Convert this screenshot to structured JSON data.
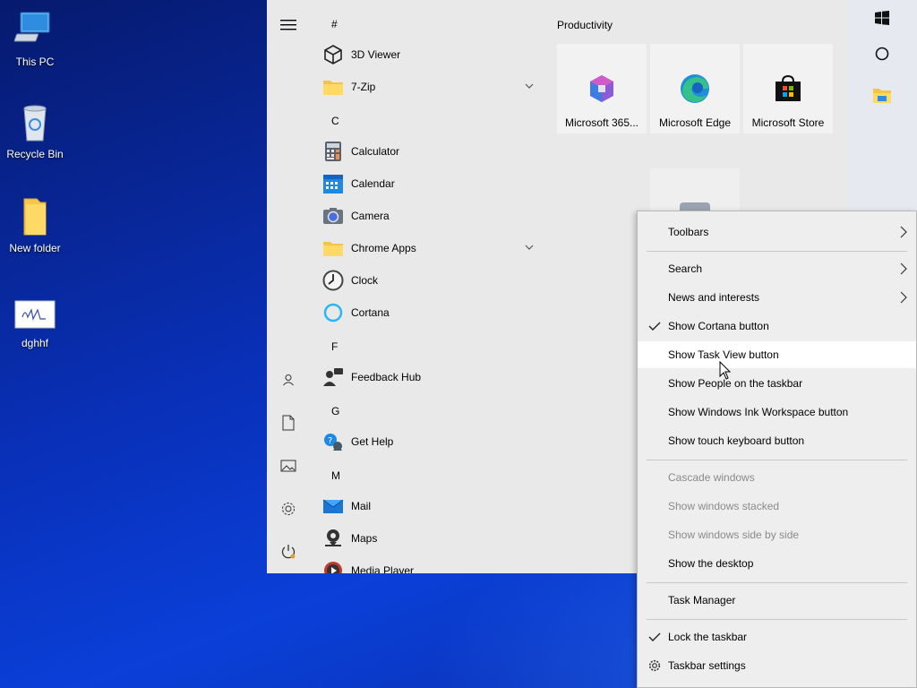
{
  "desktop": {
    "icons": [
      {
        "label": "This PC",
        "icon": "computer-icon"
      },
      {
        "label": "Recycle Bin",
        "icon": "recycle-bin-icon"
      },
      {
        "label": "New folder",
        "icon": "folder-icon"
      },
      {
        "label": "dghhf",
        "icon": "image-file-icon"
      }
    ]
  },
  "start_menu": {
    "rail": {
      "icons": [
        "hamburger-icon",
        "user-icon",
        "document-icon",
        "pictures-icon",
        "settings-icon",
        "power-icon"
      ]
    },
    "app_list": {
      "letters": [
        "#",
        "C",
        "F",
        "G",
        "M"
      ],
      "items": [
        {
          "label": "3D Viewer",
          "icon": "cube-icon"
        },
        {
          "label": "7-Zip",
          "icon": "folder-icon",
          "expandable": true
        },
        {
          "label": "Calculator",
          "icon": "calculator-icon"
        },
        {
          "label": "Calendar",
          "icon": "calendar-icon"
        },
        {
          "label": "Camera",
          "icon": "camera-icon"
        },
        {
          "label": "Chrome Apps",
          "icon": "folder-icon",
          "expandable": true
        },
        {
          "label": "Clock",
          "icon": "clock-icon"
        },
        {
          "label": "Cortana",
          "icon": "cortana-icon"
        },
        {
          "label": "Feedback Hub",
          "icon": "feedback-icon"
        },
        {
          "label": "Get Help",
          "icon": "help-icon"
        },
        {
          "label": "Mail",
          "icon": "mail-icon"
        },
        {
          "label": "Maps",
          "icon": "maps-icon"
        },
        {
          "label": "Media Player",
          "icon": "media-player-icon"
        }
      ]
    },
    "tiles": {
      "group_title": "Productivity",
      "items": [
        {
          "label": "Microsoft 365...",
          "icon": "microsoft-365-icon"
        },
        {
          "label": "Microsoft Edge",
          "icon": "edge-icon"
        },
        {
          "label": "Microsoft Store",
          "icon": "store-icon"
        }
      ]
    }
  },
  "taskbar": {
    "buttons": [
      "windows-start-icon",
      "cortana-circle-icon",
      "file-explorer-icon"
    ]
  },
  "context_menu": {
    "items": [
      {
        "label": "Toolbars",
        "submenu": true,
        "checked": false,
        "enabled": true
      },
      {
        "label": "Search",
        "submenu": true,
        "checked": false,
        "enabled": true
      },
      {
        "label": "News and interests",
        "submenu": true,
        "checked": false,
        "enabled": true
      },
      {
        "label": "Show Cortana button",
        "submenu": false,
        "checked": true,
        "enabled": true
      },
      {
        "label": "Show Task View button",
        "submenu": false,
        "checked": false,
        "enabled": true,
        "hovered": true
      },
      {
        "label": "Show People on the taskbar",
        "submenu": false,
        "checked": false,
        "enabled": true
      },
      {
        "label": "Show Windows Ink Workspace button",
        "submenu": false,
        "checked": false,
        "enabled": true
      },
      {
        "label": "Show touch keyboard button",
        "submenu": false,
        "checked": false,
        "enabled": true
      },
      {
        "label": "Cascade windows",
        "submenu": false,
        "checked": false,
        "enabled": false
      },
      {
        "label": "Show windows stacked",
        "submenu": false,
        "checked": false,
        "enabled": false
      },
      {
        "label": "Show windows side by side",
        "submenu": false,
        "checked": false,
        "enabled": false
      },
      {
        "label": "Show the desktop",
        "submenu": false,
        "checked": false,
        "enabled": true
      },
      {
        "label": "Task Manager",
        "submenu": false,
        "checked": false,
        "enabled": true
      },
      {
        "label": "Lock the taskbar",
        "submenu": false,
        "checked": true,
        "enabled": true
      },
      {
        "label": "Taskbar settings",
        "submenu": false,
        "checked": false,
        "enabled": true,
        "icon": "gear-icon"
      }
    ]
  },
  "colors": {
    "desktop_blue": "#0a3fd8",
    "start_bg": "#e9e9e9",
    "menu_bg": "#eeeeee",
    "disabled_text": "#8a8a8a"
  }
}
